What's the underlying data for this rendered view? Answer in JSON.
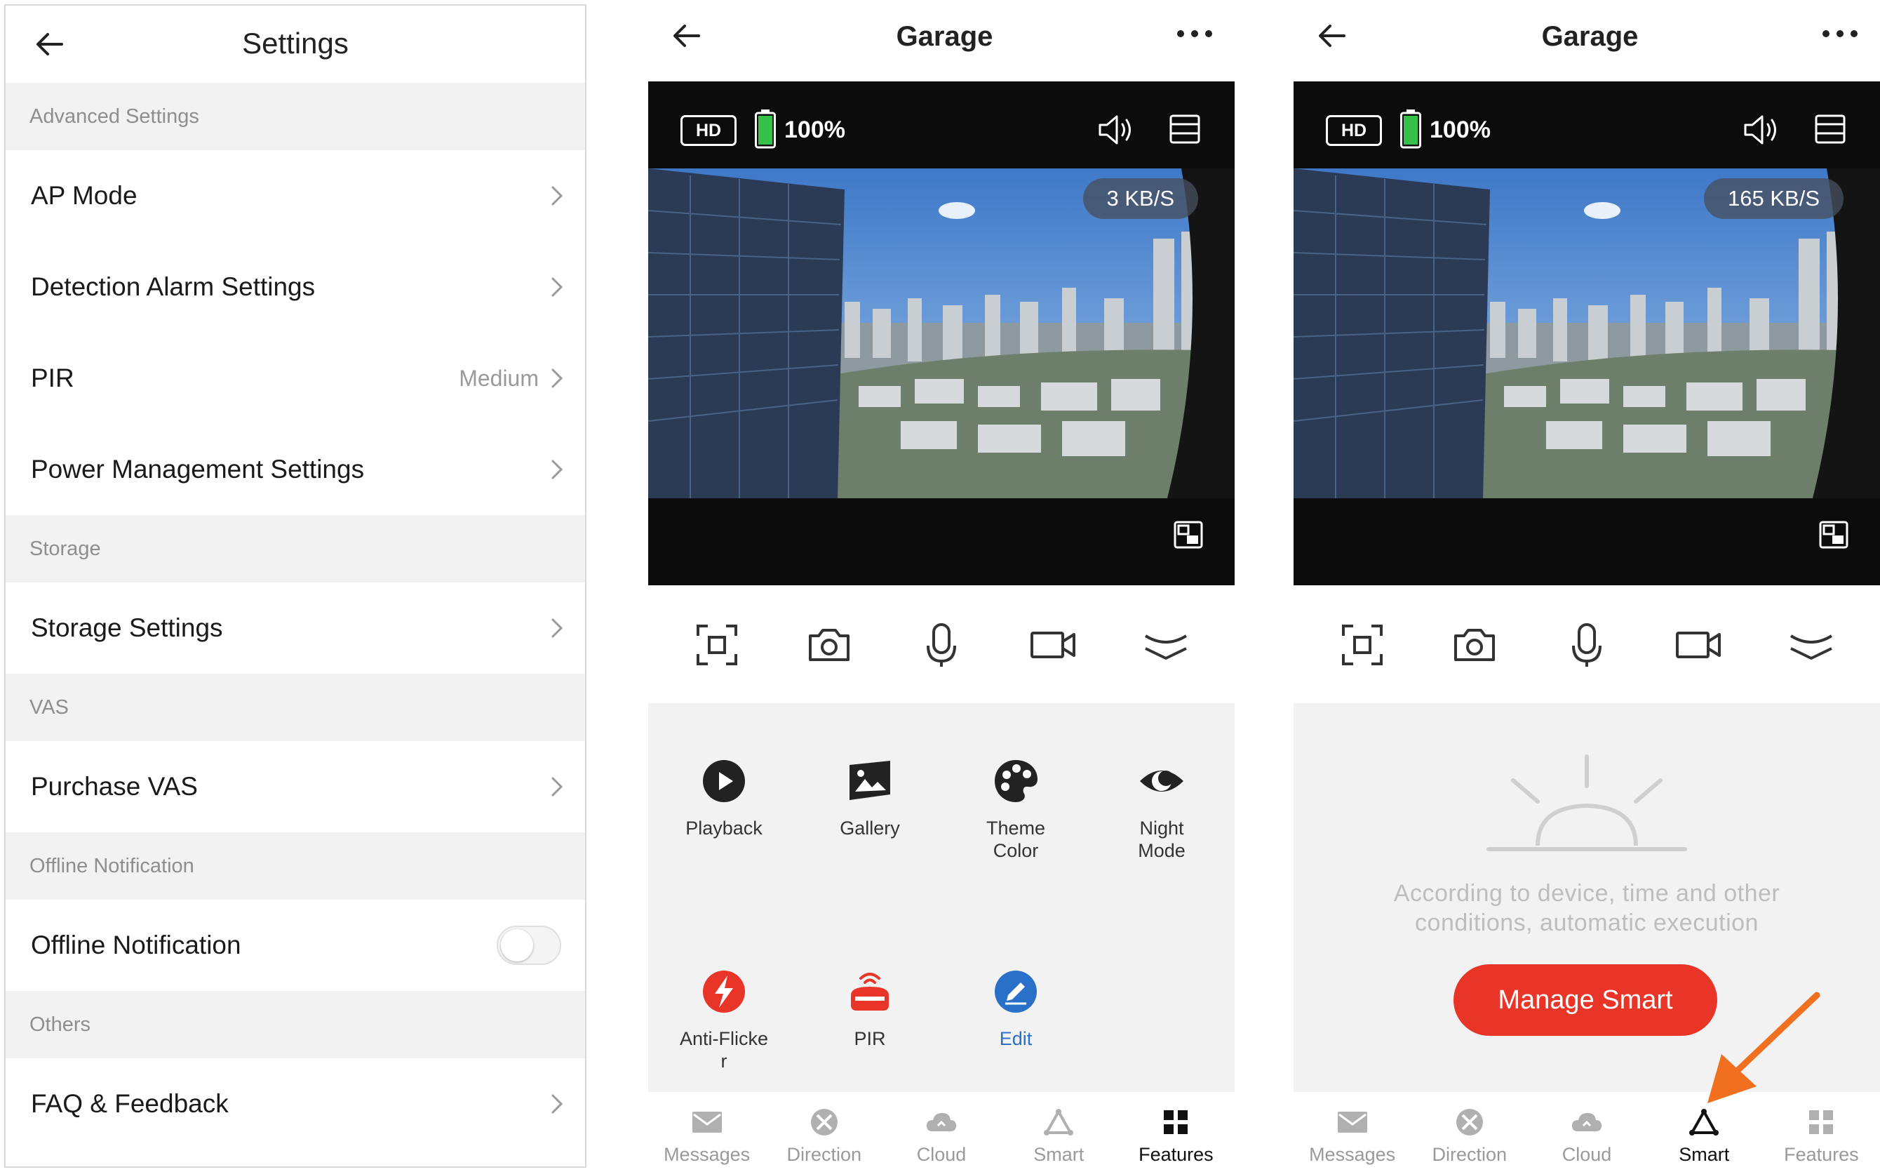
{
  "settings": {
    "title": "Settings",
    "sections": {
      "advanced": "Advanced Settings",
      "storage": "Storage",
      "vas": "VAS",
      "offline": "Offline Notification",
      "others": "Others"
    },
    "rows": {
      "ap_mode": "AP Mode",
      "detection_alarm": "Detection Alarm Settings",
      "pir": "PIR",
      "pir_value": "Medium",
      "power_management": "Power Management Settings",
      "storage_settings": "Storage Settings",
      "purchase_vas": "Purchase VAS",
      "offline_notification": "Offline Notification",
      "offline_notification_enabled": false,
      "faq": "FAQ & Feedback"
    }
  },
  "camera_panels": [
    {
      "title": "Garage",
      "hd": "HD",
      "battery": "100%",
      "battery_level": 1.0,
      "speed": "3 KB/S",
      "features": {
        "playback": "Playback",
        "gallery": "Gallery",
        "theme_line1": "Theme",
        "theme_line2": "Color",
        "night_line1": "Night",
        "night_line2": "Mode",
        "anti_line1": "Anti-Flicke",
        "anti_line2": "r",
        "pir": "PIR",
        "edit": "Edit"
      }
    },
    {
      "title": "Garage",
      "hd": "HD",
      "battery": "100%",
      "battery_level": 1.0,
      "speed": "165 KB/S",
      "smart_hint_line1": "According to device, time and other",
      "smart_hint_line2": "conditions, automatic execution",
      "manage_smart": "Manage Smart"
    }
  ],
  "tabs": {
    "messages": "Messages",
    "direction": "Direction",
    "cloud": "Cloud",
    "smart": "Smart",
    "features": "Features"
  },
  "colors": {
    "accent_red": "#e83527",
    "battery_green": "#36c24a",
    "link_blue": "#2a70c8",
    "pointer_arrow": "#f07020"
  },
  "icons": {
    "back": "left-arrow-icon",
    "more": "ellipsis-icon",
    "chevron": "chevron-right-icon",
    "speaker": "speaker-icon",
    "fullscreen": "rectangle-menu-icon",
    "pip": "picture-in-picture-icon"
  }
}
